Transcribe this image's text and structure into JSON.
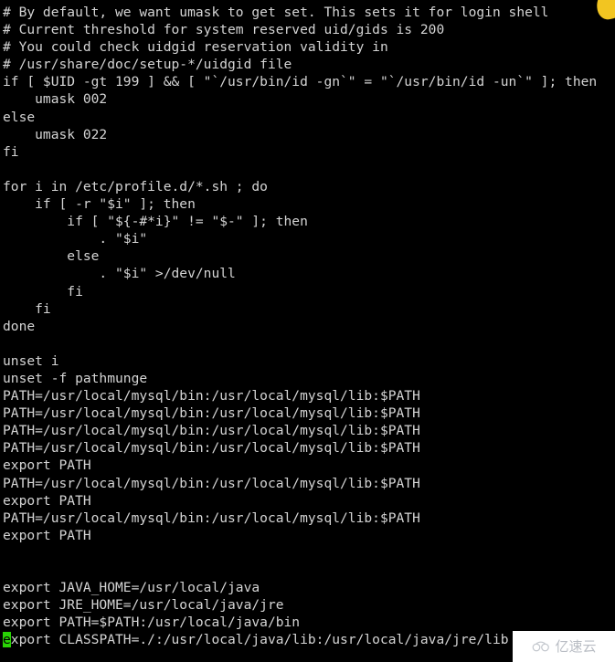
{
  "terminal": {
    "background_color": "#000000",
    "foreground_color": "#d4d4d4",
    "cursor_color": "#29d305",
    "cursor_char": "e",
    "lines": [
      "# By default, we want umask to get set. This sets it for login shell",
      "# Current threshold for system reserved uid/gids is 200",
      "# You could check uidgid reservation validity in",
      "# /usr/share/doc/setup-*/uidgid file",
      "if [ $UID -gt 199 ] && [ \"`/usr/bin/id -gn`\" = \"`/usr/bin/id -un`\" ]; then",
      "    umask 002",
      "else",
      "    umask 022",
      "fi",
      "",
      "for i in /etc/profile.d/*.sh ; do",
      "    if [ -r \"$i\" ]; then",
      "        if [ \"${-#*i}\" != \"$-\" ]; then",
      "            . \"$i\"",
      "        else",
      "            . \"$i\" >/dev/null",
      "        fi",
      "    fi",
      "done",
      "",
      "unset i",
      "unset -f pathmunge",
      "PATH=/usr/local/mysql/bin:/usr/local/mysql/lib:$PATH",
      "PATH=/usr/local/mysql/bin:/usr/local/mysql/lib:$PATH",
      "PATH=/usr/local/mysql/bin:/usr/local/mysql/lib:$PATH",
      "PATH=/usr/local/mysql/bin:/usr/local/mysql/lib:$PATH",
      "export PATH",
      "PATH=/usr/local/mysql/bin:/usr/local/mysql/lib:$PATH",
      "export PATH",
      "PATH=/usr/local/mysql/bin:/usr/local/mysql/lib:$PATH",
      "export PATH",
      "",
      "",
      "export JAVA_HOME=/usr/local/java",
      "export JRE_HOME=/usr/local/java/jre",
      "export PATH=$PATH:/usr/local/java/bin"
    ],
    "cursor_line_prefix": "e",
    "cursor_line_rest": "xport CLASSPATH=./:/usr/local/java/lib:/usr/local/java/jre/lib"
  },
  "watermark": {
    "text": "亿速云",
    "icon": "cloud-icon",
    "background_color": "#ffffff",
    "text_color": "#b9bdc4"
  },
  "corner_mark": {
    "icon": "yellow-marker-shape",
    "color": "#f2c521"
  }
}
